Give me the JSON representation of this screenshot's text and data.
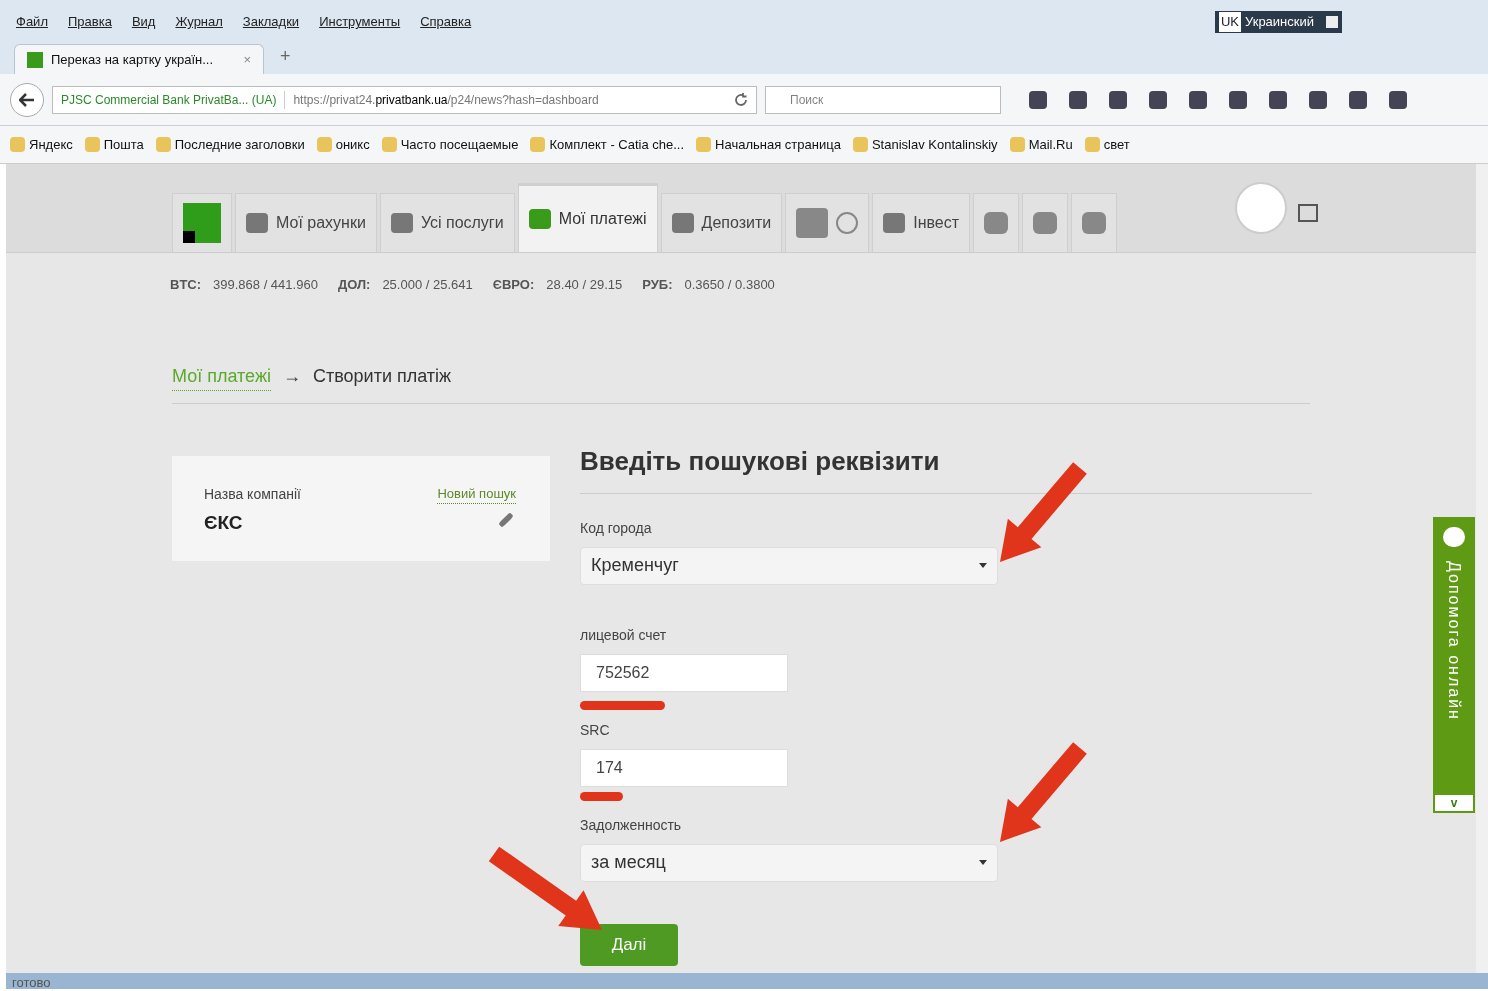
{
  "menu_bar": [
    "Файл",
    "Правка",
    "Вид",
    "Журнал",
    "Закладки",
    "Инструменты",
    "Справка"
  ],
  "language_indicator": {
    "code": "UK",
    "label": "Украинский"
  },
  "browser_tab": {
    "title": "Переказ на картку україн...",
    "close": "×",
    "new_tab": "+"
  },
  "address_bar": {
    "site_identity": "PJSC Commercial Bank PrivatBa... (UA)",
    "url_prefix": "https://privat24.",
    "url_domain": "privatbank.ua",
    "url_path": "/p24/news?hash=dashboard"
  },
  "search_field": {
    "placeholder": "Поиск"
  },
  "bookmarks": [
    "Яндекс",
    "Пошта",
    "Последние заголовки",
    "оникс",
    "Часто посещаемые",
    "Комплект - Catia che...",
    "Начальная страница",
    "Stanislav Kontalinskiy",
    "Mail.Ru",
    "свет"
  ],
  "nav_tabs": [
    {
      "kind": "logo",
      "selected": false
    },
    {
      "kind": "labeled",
      "label": "Мої рахунки",
      "selected": false
    },
    {
      "kind": "labeled",
      "label": "Усі послуги",
      "selected": false
    },
    {
      "kind": "labeled",
      "label": "Мої платежі",
      "selected": true
    },
    {
      "kind": "labeled",
      "label": "Депозити",
      "selected": false
    },
    {
      "kind": "icons",
      "selected": false
    },
    {
      "kind": "labeled",
      "label": "Інвест",
      "selected": false
    },
    {
      "kind": "icon",
      "selected": false
    },
    {
      "kind": "icon",
      "selected": false
    },
    {
      "kind": "icon",
      "selected": false
    }
  ],
  "rates": [
    {
      "code": "BTC:",
      "value": "399.868 / 441.960"
    },
    {
      "code": "ДОЛ:",
      "value": "25.000 / 25.641"
    },
    {
      "code": "ЄВРО:",
      "value": "28.40 / 29.15"
    },
    {
      "code": "РУБ:",
      "value": "0.3650 / 0.3800"
    }
  ],
  "breadcrumb": {
    "link": "Мої платежі",
    "separator": "→",
    "current": "Створити платіж"
  },
  "company_card": {
    "label": "Назва компанії",
    "value": "ЄКС",
    "new_search_link": "Новий пошук"
  },
  "form": {
    "heading": "Введіть пошукові реквізити",
    "fields": [
      {
        "kind": "select",
        "label": "Код города",
        "value": "Кременчуг"
      },
      {
        "kind": "input",
        "label": "лицевой счет",
        "value": "752562"
      },
      {
        "kind": "input",
        "label": "SRC",
        "value": "174"
      },
      {
        "kind": "select",
        "label": "Задолженность",
        "value": "за месяц"
      }
    ],
    "submit": "Далі"
  },
  "help_widget": {
    "label": "Допомога онлайн",
    "toggle": "v"
  },
  "status_bar": "готово"
}
